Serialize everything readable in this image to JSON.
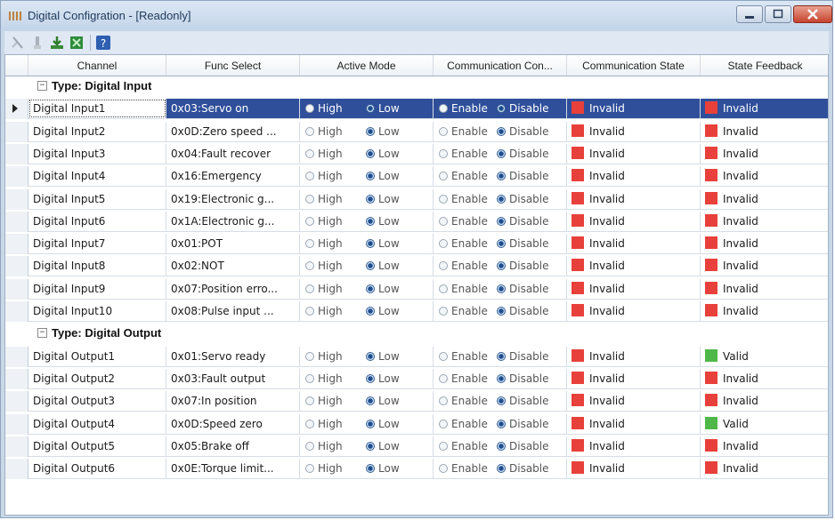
{
  "window": {
    "title": "Digital Configration - [Readonly]"
  },
  "columns": [
    "Channel",
    "Func Select",
    "Active Mode",
    "Communication Con...",
    "Communication State",
    "State Feedback"
  ],
  "groups": [
    {
      "label": "Type: Digital Input",
      "toggle": "−",
      "rows": [
        {
          "channel": "Digital Input1",
          "func": "0x03:Servo on",
          "active": "Low",
          "comm": "Disable",
          "state": "Invalid",
          "feedback": "Invalid",
          "selected": true
        },
        {
          "channel": "Digital Input2",
          "func": "0x0D:Zero speed ...",
          "active": "Low",
          "comm": "Disable",
          "state": "Invalid",
          "feedback": "Invalid"
        },
        {
          "channel": "Digital Input3",
          "func": "0x04:Fault recover",
          "active": "Low",
          "comm": "Disable",
          "state": "Invalid",
          "feedback": "Invalid"
        },
        {
          "channel": "Digital Input4",
          "func": "0x16:Emergency",
          "active": "Low",
          "comm": "Disable",
          "state": "Invalid",
          "feedback": "Invalid"
        },
        {
          "channel": "Digital Input5",
          "func": "0x19:Electronic g...",
          "active": "Low",
          "comm": "Disable",
          "state": "Invalid",
          "feedback": "Invalid"
        },
        {
          "channel": "Digital Input6",
          "func": "0x1A:Electronic g...",
          "active": "Low",
          "comm": "Disable",
          "state": "Invalid",
          "feedback": "Invalid"
        },
        {
          "channel": "Digital Input7",
          "func": "0x01:POT",
          "active": "Low",
          "comm": "Disable",
          "state": "Invalid",
          "feedback": "Invalid"
        },
        {
          "channel": "Digital Input8",
          "func": "0x02:NOT",
          "active": "Low",
          "comm": "Disable",
          "state": "Invalid",
          "feedback": "Invalid"
        },
        {
          "channel": "Digital Input9",
          "func": "0x07:Position erro...",
          "active": "Low",
          "comm": "Disable",
          "state": "Invalid",
          "feedback": "Invalid"
        },
        {
          "channel": "Digital Input10",
          "func": "0x08:Pulse input ...",
          "active": "Low",
          "comm": "Disable",
          "state": "Invalid",
          "feedback": "Invalid"
        }
      ]
    },
    {
      "label": "Type: Digital Output",
      "toggle": "−",
      "rows": [
        {
          "channel": "Digital Output1",
          "func": "0x01:Servo ready",
          "active": "Low",
          "comm": "Disable",
          "state": "Invalid",
          "feedback": "Valid"
        },
        {
          "channel": "Digital Output2",
          "func": "0x03:Fault output",
          "active": "Low",
          "comm": "Disable",
          "state": "Invalid",
          "feedback": "Invalid"
        },
        {
          "channel": "Digital Output3",
          "func": "0x07:In position",
          "active": "Low",
          "comm": "Disable",
          "state": "Invalid",
          "feedback": "Invalid"
        },
        {
          "channel": "Digital Output4",
          "func": "0x0D:Speed zero",
          "active": "Low",
          "comm": "Disable",
          "state": "Invalid",
          "feedback": "Valid"
        },
        {
          "channel": "Digital Output5",
          "func": "0x05:Brake off",
          "active": "Low",
          "comm": "Disable",
          "state": "Invalid",
          "feedback": "Invalid"
        },
        {
          "channel": "Digital Output6",
          "func": "0x0E:Torque limit...",
          "active": "Low",
          "comm": "Disable",
          "state": "Invalid",
          "feedback": "Invalid"
        }
      ]
    }
  ],
  "labels": {
    "high": "High",
    "low": "Low",
    "enable": "Enable",
    "disable": "Disable"
  },
  "colors": {
    "invalid": "#e8403a",
    "valid": "#4fb848",
    "selection": "#2f4f9a"
  }
}
